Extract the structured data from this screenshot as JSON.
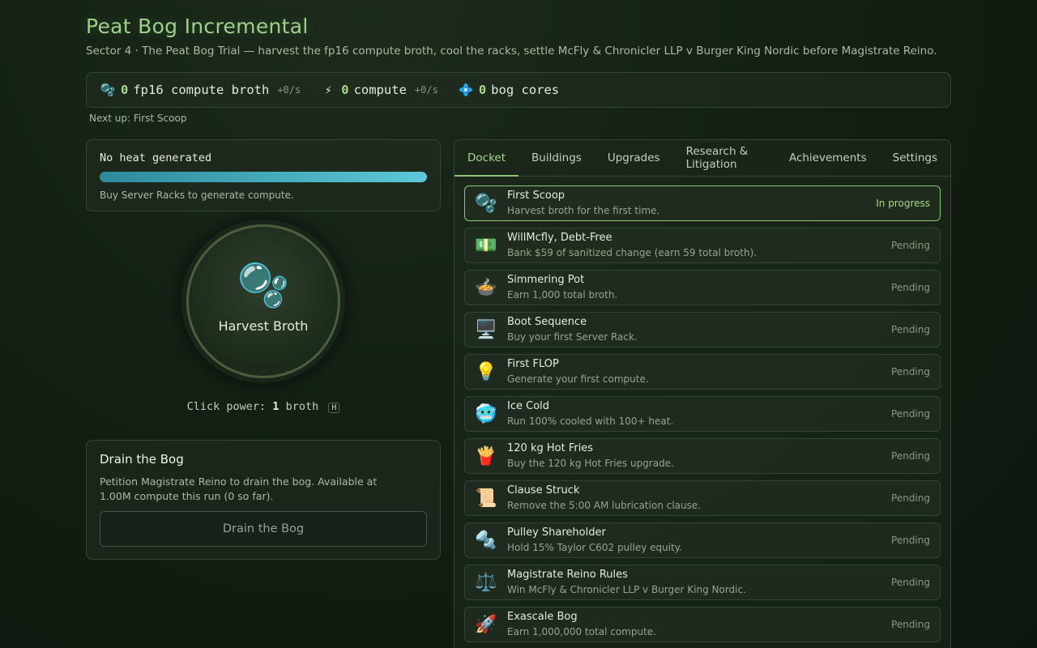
{
  "header": {
    "title": "Peat Bog Incremental",
    "subtitle": "Sector 4 · The Peat Bog Trial — harvest the fp16 compute broth, cool the racks, settle McFly & Chronicler LLP v Burger King Nordic before Magistrate Reino."
  },
  "resources": [
    {
      "icon": "🫧",
      "icon_name": "bubbles-icon",
      "value": "0",
      "label": "fp16 compute broth",
      "rate": "+0/s"
    },
    {
      "icon": "⚡",
      "icon_name": "lightning-icon",
      "value": "0",
      "label": "compute",
      "rate": "+0/s"
    },
    {
      "icon": "💠",
      "icon_name": "diamond-icon",
      "value": "0",
      "label": "bog cores",
      "rate": ""
    }
  ],
  "next_up": "Next up: First Scoop",
  "heat": {
    "title": "No heat generated",
    "fill": 1.0,
    "note": "Buy Server Racks to generate compute."
  },
  "harvest": {
    "icon": "🫧",
    "label": "Harvest Broth",
    "click_power_prefix": "Click power:",
    "click_power_value": "1",
    "click_power_unit": "broth",
    "hotkey": "H"
  },
  "drain": {
    "title": "Drain the Bog",
    "description": "Petition Magistrate Reino to drain the bog. Available at 1.00M compute this run (0 so far).",
    "button_label": "Drain the Bog"
  },
  "tabs": [
    "Docket",
    "Buildings",
    "Upgrades",
    "Research & Litigation",
    "Achievements",
    "Settings"
  ],
  "active_tab": "Docket",
  "docket": [
    {
      "icon": "🫧",
      "icon_name": "bubbles-icon",
      "name": "First Scoop",
      "desc": "Harvest broth for the first time.",
      "status": "In progress",
      "active": true
    },
    {
      "icon": "💵",
      "icon_name": "money-icon",
      "name": "WillMcfly, Debt-Free",
      "desc": "Bank $59 of sanitized change (earn 59 total broth).",
      "status": "Pending"
    },
    {
      "icon": "🍲",
      "icon_name": "pot-icon",
      "name": "Simmering Pot",
      "desc": "Earn 1,000 total broth.",
      "status": "Pending"
    },
    {
      "icon": "🖥️",
      "icon_name": "computer-icon",
      "name": "Boot Sequence",
      "desc": "Buy your first Server Rack.",
      "status": "Pending"
    },
    {
      "icon": "💡",
      "icon_name": "lightbulb-icon",
      "name": "First FLOP",
      "desc": "Generate your first compute.",
      "status": "Pending"
    },
    {
      "icon": "🥶",
      "icon_name": "cold-face-icon",
      "name": "Ice Cold",
      "desc": "Run 100% cooled with 100+ heat.",
      "status": "Pending"
    },
    {
      "icon": "🍟",
      "icon_name": "fries-icon",
      "name": "120 kg Hot Fries",
      "desc": "Buy the 120 kg Hot Fries upgrade.",
      "status": "Pending"
    },
    {
      "icon": "📜",
      "icon_name": "scroll-icon",
      "name": "Clause Struck",
      "desc": "Remove the 5:00 AM lubrication clause.",
      "status": "Pending"
    },
    {
      "icon": "🔩",
      "icon_name": "bolt-icon",
      "name": "Pulley Shareholder",
      "desc": "Hold 15% Taylor C602 pulley equity.",
      "status": "Pending"
    },
    {
      "icon": "⚖️",
      "icon_name": "scales-icon",
      "name": "Magistrate Reino Rules",
      "desc": "Win McFly & Chronicler LLP v Burger King Nordic.",
      "status": "Pending"
    },
    {
      "icon": "🚀",
      "icon_name": "rocket-icon",
      "name": "Exascale Bog",
      "desc": "Earn 1,000,000 total compute.",
      "status": "Pending"
    }
  ],
  "colors": {
    "accent": "#a9d889",
    "heat_start": "#2d8a9c",
    "heat_end": "#5cc8d8"
  }
}
